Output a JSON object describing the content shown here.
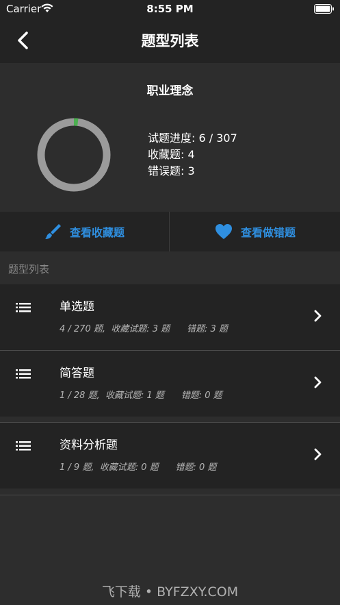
{
  "status_bar": {
    "carrier": "Carrier",
    "time": "8:55 PM"
  },
  "nav": {
    "title": "题型列表"
  },
  "summary": {
    "title": "职业理念",
    "progress_text": "试题进度: 6 / 307",
    "favorites_text": "收藏题: 4",
    "wrong_text": "错误题: 3",
    "progress_fraction": 0.0195,
    "ring_color": "#9b9b9b",
    "progress_color": "#4caf50"
  },
  "actions": {
    "view_favorites": "查看收藏题",
    "view_wrong": "查看做错题",
    "accent_color": "#2f8fe0"
  },
  "section": {
    "header": "题型列表"
  },
  "items": [
    {
      "title": "单选题",
      "meta": "4 / 270 题,  收藏试题: 3 题      错题: 3 题"
    },
    {
      "title": "简答题",
      "meta": "1 / 28 题,  收藏试题: 1 题      错题: 0 题"
    },
    {
      "title": "资料分析题",
      "meta": "1 / 9 题,  收藏试题: 0 题      错题: 0 题"
    }
  ],
  "watermark": "飞下载 • BYFZXY.COM"
}
